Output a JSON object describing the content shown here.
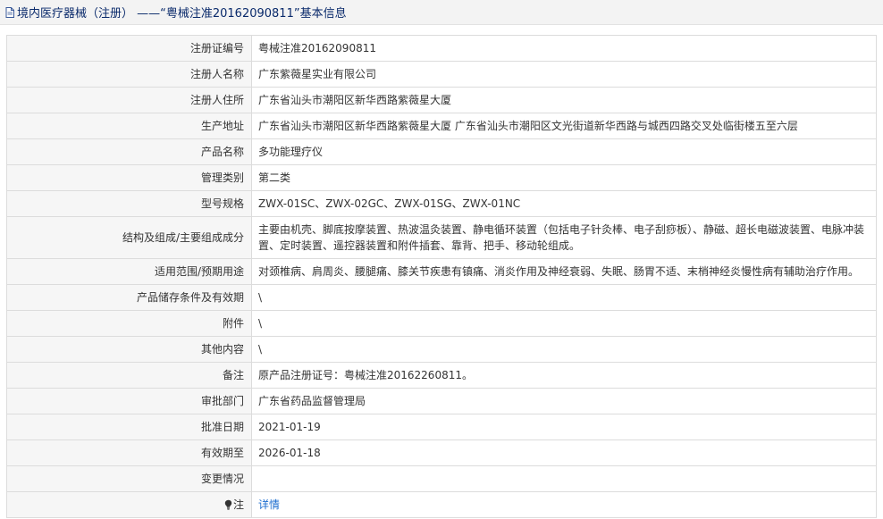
{
  "header": {
    "title": "境内医疗器械（注册） ——“粤械注准20162090811”基本信息"
  },
  "rows": [
    {
      "label": "注册证编号",
      "value": "粤械注准20162090811"
    },
    {
      "label": "注册人名称",
      "value": "广东紫薇星实业有限公司"
    },
    {
      "label": "注册人住所",
      "value": "广东省汕头市潮阳区新华西路紫薇星大厦"
    },
    {
      "label": "生产地址",
      "value": "广东省汕头市潮阳区新华西路紫薇星大厦 广东省汕头市潮阳区文光街道新华西路与城西四路交叉处临街楼五至六层"
    },
    {
      "label": "产品名称",
      "value": "多功能理疗仪"
    },
    {
      "label": "管理类别",
      "value": "第二类"
    },
    {
      "label": "型号规格",
      "value": "ZWX-01SC、ZWX-02GC、ZWX-01SG、ZWX-01NC"
    },
    {
      "label": "结构及组成/主要组成成分",
      "value": "主要由机壳、脚底按摩装置、热波温灸装置、静电循环装置（包括电子针灸棒、电子刮痧板）、静磁、超长电磁波装置、电脉冲装置、定时装置、遥控器装置和附件插套、靠背、把手、移动轮组成。"
    },
    {
      "label": "适用范围/预期用途",
      "value": "对颈椎病、肩周炎、腰腿痛、膝关节疾患有镇痛、消炎作用及神经衰弱、失眠、肠胃不适、末梢神经炎慢性病有辅助治疗作用。"
    },
    {
      "label": "产品储存条件及有效期",
      "value": "\\"
    },
    {
      "label": "附件",
      "value": "\\"
    },
    {
      "label": "其他内容",
      "value": "\\"
    },
    {
      "label": "备注",
      "value": "原产品注册证号：粤械注准20162260811。"
    },
    {
      "label": "审批部门",
      "value": "广东省药品监督管理局"
    },
    {
      "label": "批准日期",
      "value": "2021-01-19"
    },
    {
      "label": "有效期至",
      "value": "2026-01-18"
    },
    {
      "label": "变更情况",
      "value": ""
    }
  ],
  "note": {
    "label": "注",
    "link_text": "详情",
    "icon": "lightbulb-icon"
  },
  "colors": {
    "title_text": "#0a2a6b",
    "link": "#1c6dcf",
    "label_bg": "#f6f6f6",
    "border": "#dcdcdc"
  }
}
